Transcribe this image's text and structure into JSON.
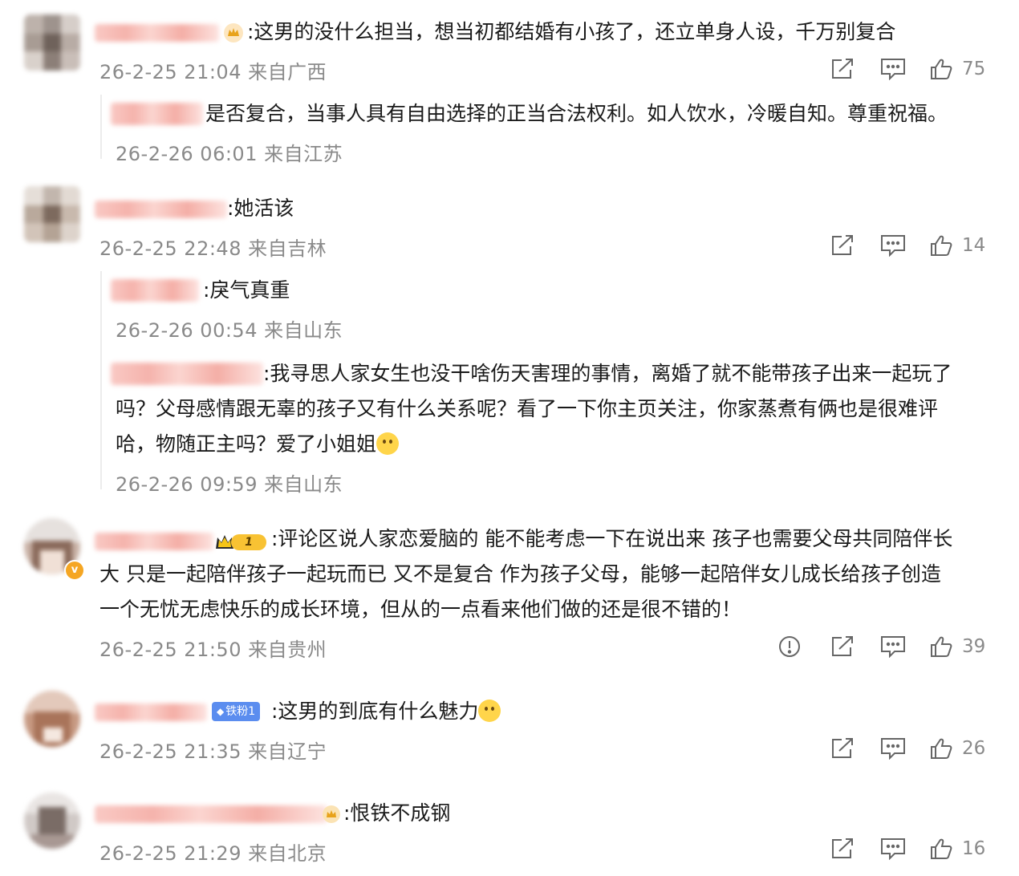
{
  "comments": [
    {
      "text": ":这男的没什么担当，想当初都结婚有小孩了，还立单身人设，千万别复合",
      "meta": "26-2-25 21:04 来自广西",
      "likes": "75",
      "replies": [
        {
          "text": "是否复合，当事人具有自由选择的正当合法权利。如人饮水，冷暖自知。尊重祝福。",
          "meta": "26-2-26 06:01 来自江苏"
        }
      ]
    },
    {
      "text": ":她活该",
      "meta": "26-2-25 22:48 来自吉林",
      "likes": "14",
      "replies": [
        {
          "text": ":戾气真重",
          "meta": "26-2-26 00:54 来自山东"
        },
        {
          "text_lines": [
            ":我寻思人家女生也没干啥伤天害理的事情，离婚了就不能带孩子出来一起玩了",
            "吗？父母感情跟无辜的孩子又有什么关系呢？看了一下你主页关注，你家蒸煮有俩也是很难评",
            "哈，物随正主吗？爱了小姐姐"
          ],
          "meta": "26-2-26 09:59 来自山东"
        }
      ]
    },
    {
      "badge": "1",
      "text_lines": [
        ":评论区说人家恋爱脑的 能不能考虑一下在说出来 孩子也需要父母共同陪伴长",
        "大 只是一起陪伴孩子一起玩而已 又不是复合 作为孩子父母，能够一起陪伴女儿成长给孩子创造",
        "一个无忧无虑快乐的成长环境，但从的一点看来他们做的还是很不错的！"
      ],
      "meta": "26-2-25 21:50 来自贵州",
      "likes": "39",
      "avatar_badge": "v"
    },
    {
      "badge": "铁粉1",
      "text": ":这男的到底有什么魅力",
      "meta": "26-2-25 21:35 来自辽宁",
      "likes": "26"
    },
    {
      "text": ":恨铁不成钢",
      "meta": "26-2-25 21:29 来自北京",
      "likes": "16"
    }
  ],
  "colors": {
    "accent": "#f5a623",
    "meta": "#8a8a8a",
    "fan_badge": "#5b8def"
  },
  "icons": [
    "share-icon",
    "comment-icon",
    "like-icon",
    "report-icon",
    "crown-icon",
    "emoji-icon"
  ]
}
